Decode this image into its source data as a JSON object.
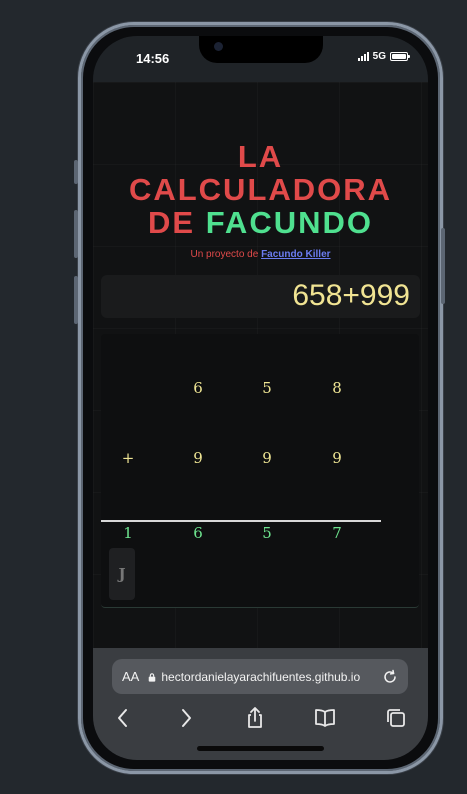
{
  "status": {
    "time": "14:56",
    "network": "5G"
  },
  "app": {
    "title_line1": "LA",
    "title_line2": "CALCULADORA",
    "title_de": "DE",
    "title_name": "FACUNDO",
    "subtitle_prefix": "Un proyecto de",
    "subtitle_link": "Facundo Killer"
  },
  "display": {
    "expression": "658+999"
  },
  "sum": {
    "row1": [
      "",
      "6",
      "5",
      "8"
    ],
    "row2": [
      "+",
      "9",
      "9",
      "9"
    ],
    "result": [
      "1",
      "6",
      "5",
      "7"
    ],
    "button_label": "J"
  },
  "browser": {
    "aa_label": "AA",
    "url": "hectordanielayarachifuentes.github.io"
  },
  "colors": {
    "title_red": "#e04a4a",
    "title_green": "#4fe08f",
    "display_text": "#f1e493",
    "link_blue": "#6b7cf0",
    "result_green": "#6ee58f"
  },
  "icons": [
    "lock-icon",
    "reload-icon",
    "back-icon",
    "forward-icon",
    "share-icon",
    "bookmarks-icon",
    "tabs-icon"
  ]
}
